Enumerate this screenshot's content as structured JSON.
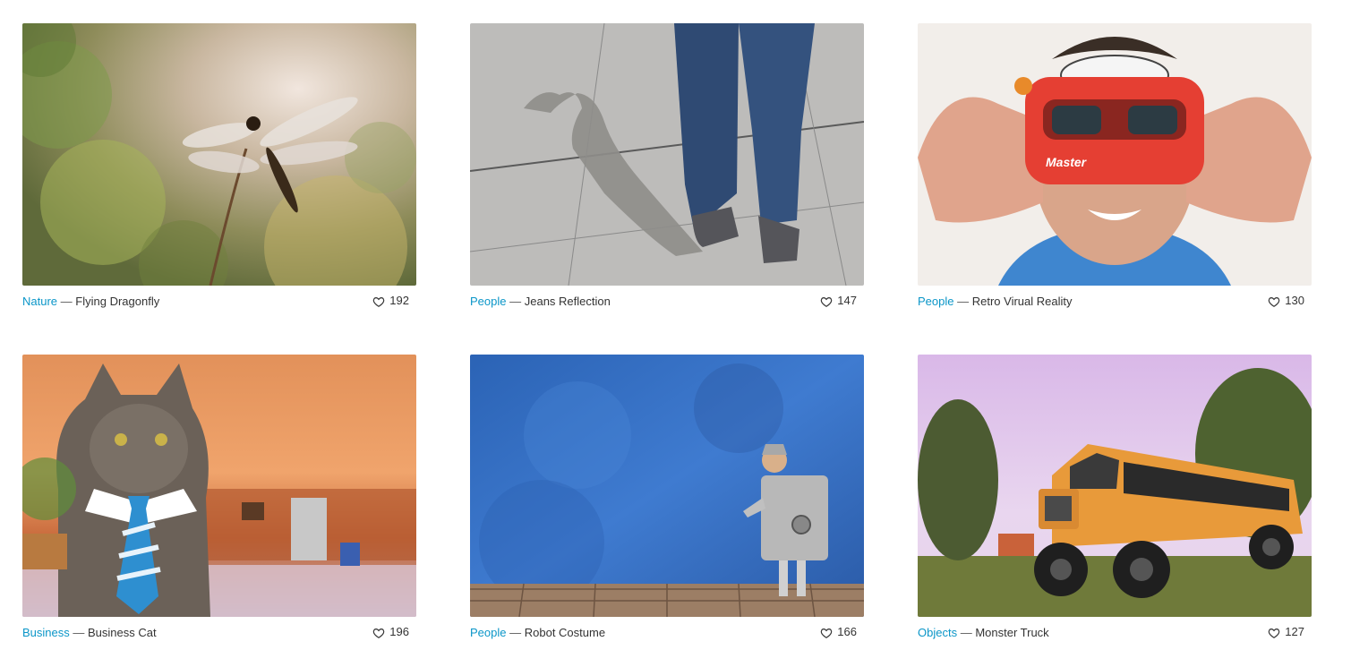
{
  "gallery": {
    "cards": [
      {
        "category": "Nature",
        "separator": "—",
        "title": "Flying Dragonfly",
        "likes": "192",
        "image": "dragonfly-photo"
      },
      {
        "category": "People",
        "separator": "—",
        "title": "Jeans Reflection",
        "likes": "147",
        "image": "jeans-shadow-photo"
      },
      {
        "category": "People",
        "separator": "—",
        "title": "Retro Virual Reality",
        "likes": "130",
        "image": "viewmaster-photo"
      },
      {
        "category": "Business",
        "separator": "—",
        "title": "Business Cat",
        "likes": "196",
        "image": "cat-in-tie-photo"
      },
      {
        "category": "People",
        "separator": "—",
        "title": "Robot Costume",
        "likes": "166",
        "image": "robot-costume-photo"
      },
      {
        "category": "Objects",
        "separator": "—",
        "title": "Monster Truck",
        "likes": "127",
        "image": "monster-bus-photo"
      }
    ]
  },
  "photo_text": {
    "viewmaster_brand": "Master"
  },
  "icons": {
    "like": "heart-outline-icon"
  },
  "colors": {
    "category_link": "#0b96c8",
    "text": "#333333",
    "background": "#ffffff"
  }
}
